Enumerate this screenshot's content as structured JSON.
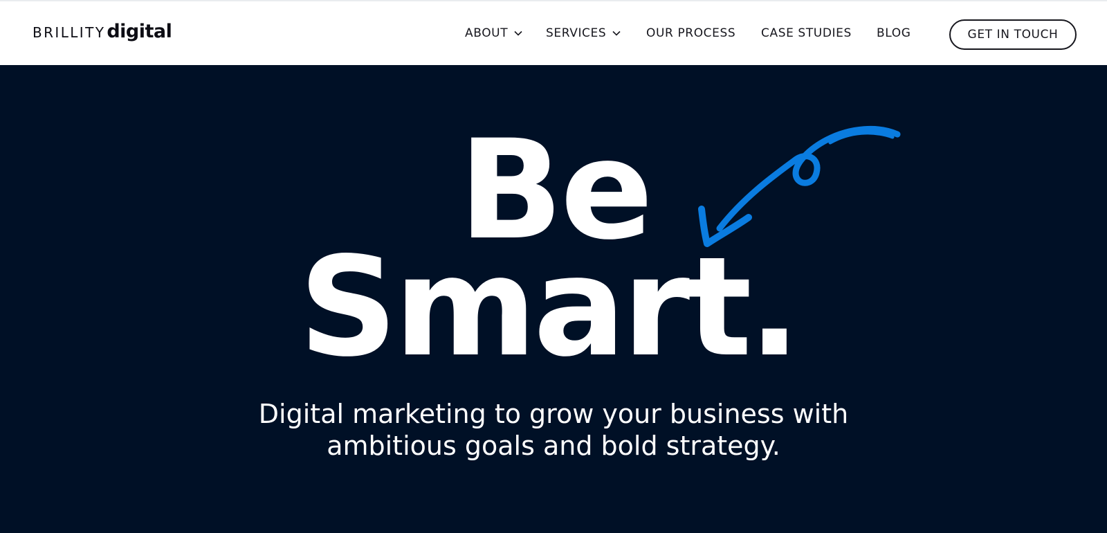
{
  "header": {
    "logo_light": "BRILLITY",
    "logo_bold": "digital",
    "nav": [
      {
        "label": "ABOUT",
        "has_dropdown": true
      },
      {
        "label": "SERVICES",
        "has_dropdown": true
      },
      {
        "label": "OUR PROCESS",
        "has_dropdown": false
      },
      {
        "label": "CASE STUDIES",
        "has_dropdown": false
      },
      {
        "label": "BLOG",
        "has_dropdown": false
      }
    ],
    "cta_label": "GET IN TOUCH"
  },
  "hero": {
    "headline_line1": "Be",
    "headline_line2": "Smart.",
    "subtitle_line1": "Digital marketing to grow your business with",
    "subtitle_line2": "ambitious goals and bold strategy."
  },
  "colors": {
    "background": "#001026",
    "header_bg": "#ffffff",
    "accent_arrow": "#0a7ce0",
    "text_light": "#ffffff",
    "text_dark": "#16161d"
  },
  "icons": {
    "dropdown": "chevron-down-icon",
    "decoration": "hand-drawn-arrow-icon"
  }
}
